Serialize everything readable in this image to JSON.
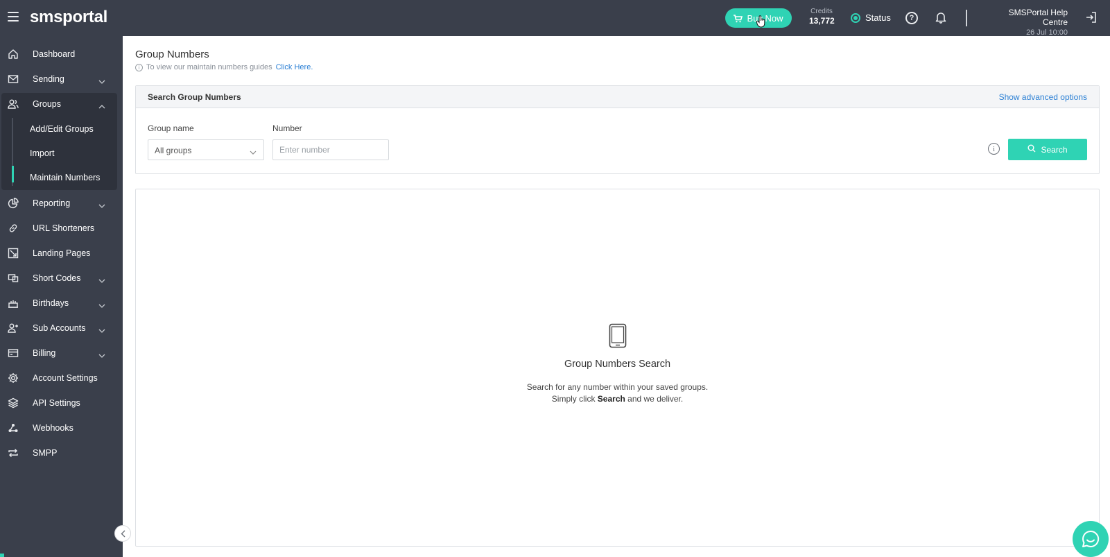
{
  "topbar": {
    "logo_a": "sms",
    "logo_b": "portal",
    "buy_now": "Buy Now",
    "credits_label": "Credits",
    "credits_value": "13,772",
    "status_label": "Status",
    "help_centre": "SMSPortal Help Centre",
    "date": "26 Jul 10:00"
  },
  "sidebar": {
    "items": [
      {
        "label": "Dashboard",
        "icon": "home-icon"
      },
      {
        "label": "Sending",
        "icon": "envelope-icon"
      },
      {
        "label": "Groups",
        "icon": "users-icon"
      },
      {
        "label": "Reporting",
        "icon": "pie-chart-icon"
      },
      {
        "label": "URL Shorteners",
        "icon": "link-icon"
      },
      {
        "label": "Landing Pages",
        "icon": "landing-page-icon"
      },
      {
        "label": "Short Codes",
        "icon": "short-code-icon"
      },
      {
        "label": "Birthdays",
        "icon": "cake-icon"
      },
      {
        "label": "Sub Accounts",
        "icon": "user-plus-icon"
      },
      {
        "label": "Billing",
        "icon": "credit-card-icon"
      },
      {
        "label": "Account Settings",
        "icon": "gear-icon"
      },
      {
        "label": "API Settings",
        "icon": "layers-icon"
      },
      {
        "label": "Webhooks",
        "icon": "webhook-icon"
      },
      {
        "label": "SMPP",
        "icon": "repeat-icon"
      }
    ],
    "groups_sub": [
      "Add/Edit Groups",
      "Import",
      "Maintain Numbers"
    ],
    "active_sub": "Maintain Numbers"
  },
  "main": {
    "title": "Group Numbers",
    "info_text": "To view our maintain numbers guides",
    "info_link": "Click Here.",
    "search_card": {
      "title": "Search Group Numbers",
      "advanced": "Show advanced options",
      "group_label": "Group name",
      "group_value": "All groups",
      "number_label": "Number",
      "number_placeholder": "Enter number",
      "search_button": "Search"
    },
    "empty": {
      "title": "Group Numbers Search",
      "line1": "Search for any number within your saved groups.",
      "line2_a": "Simply click ",
      "line2_b": "Search",
      "line2_c": " and we deliver."
    }
  },
  "colors": {
    "accent": "#2fd3b4",
    "sidebar": "#3a3f4b",
    "link": "#2a7fd4"
  }
}
